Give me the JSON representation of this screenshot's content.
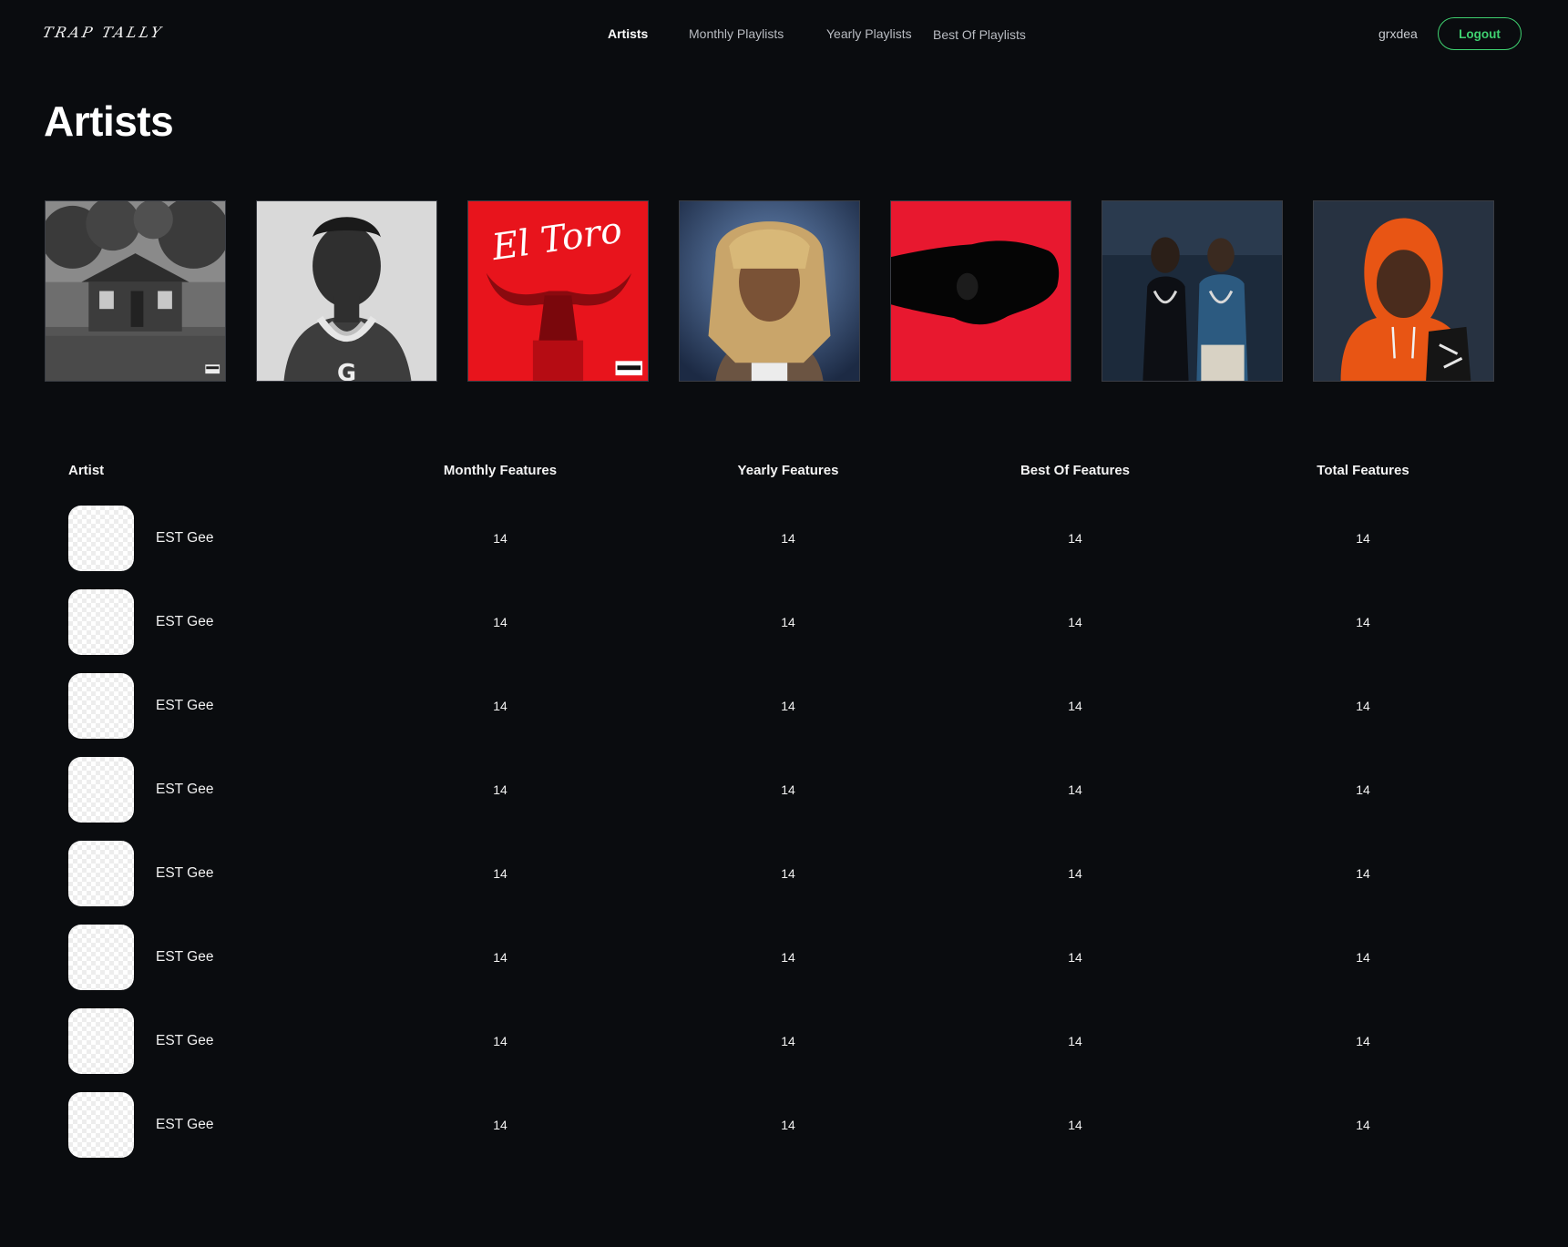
{
  "header": {
    "logo": "TRAP TALLY",
    "nav": [
      {
        "label": "Artists",
        "active": true
      },
      {
        "label": "Monthly Playlists",
        "active": false
      },
      {
        "label": "Yearly Playlists",
        "active": false
      },
      {
        "label": "Best Of Playlists",
        "active": false
      }
    ],
    "username": "grxdea",
    "logout_label": "Logout"
  },
  "colors": {
    "background": "#0a0c0f",
    "accent": "#3fd170",
    "text": "#ffffff",
    "muted_text": "#b9bcc2"
  },
  "page_title": "Artists",
  "covers": [
    {
      "name": "cover-house-bw"
    },
    {
      "name": "cover-artist-chain-bw"
    },
    {
      "name": "cover-el-toro",
      "text": "El Toro"
    },
    {
      "name": "cover-artist-blonde-locs"
    },
    {
      "name": "cover-red-silhouette"
    },
    {
      "name": "cover-two-artists"
    },
    {
      "name": "cover-orange-hoodie"
    }
  ],
  "table": {
    "headers": {
      "artist": "Artist",
      "monthly": "Monthly Features",
      "yearly": "Yearly Features",
      "bestof": "Best Of Features",
      "total": "Total Features"
    },
    "rows": [
      {
        "artist": "EST Gee",
        "monthly": "14",
        "yearly": "14",
        "bestof": "14",
        "total": "14"
      },
      {
        "artist": "EST Gee",
        "monthly": "14",
        "yearly": "14",
        "bestof": "14",
        "total": "14"
      },
      {
        "artist": "EST Gee",
        "monthly": "14",
        "yearly": "14",
        "bestof": "14",
        "total": "14"
      },
      {
        "artist": "EST Gee",
        "monthly": "14",
        "yearly": "14",
        "bestof": "14",
        "total": "14"
      },
      {
        "artist": "EST Gee",
        "monthly": "14",
        "yearly": "14",
        "bestof": "14",
        "total": "14"
      },
      {
        "artist": "EST Gee",
        "monthly": "14",
        "yearly": "14",
        "bestof": "14",
        "total": "14"
      },
      {
        "artist": "EST Gee",
        "monthly": "14",
        "yearly": "14",
        "bestof": "14",
        "total": "14"
      },
      {
        "artist": "EST Gee",
        "monthly": "14",
        "yearly": "14",
        "bestof": "14",
        "total": "14"
      }
    ]
  }
}
